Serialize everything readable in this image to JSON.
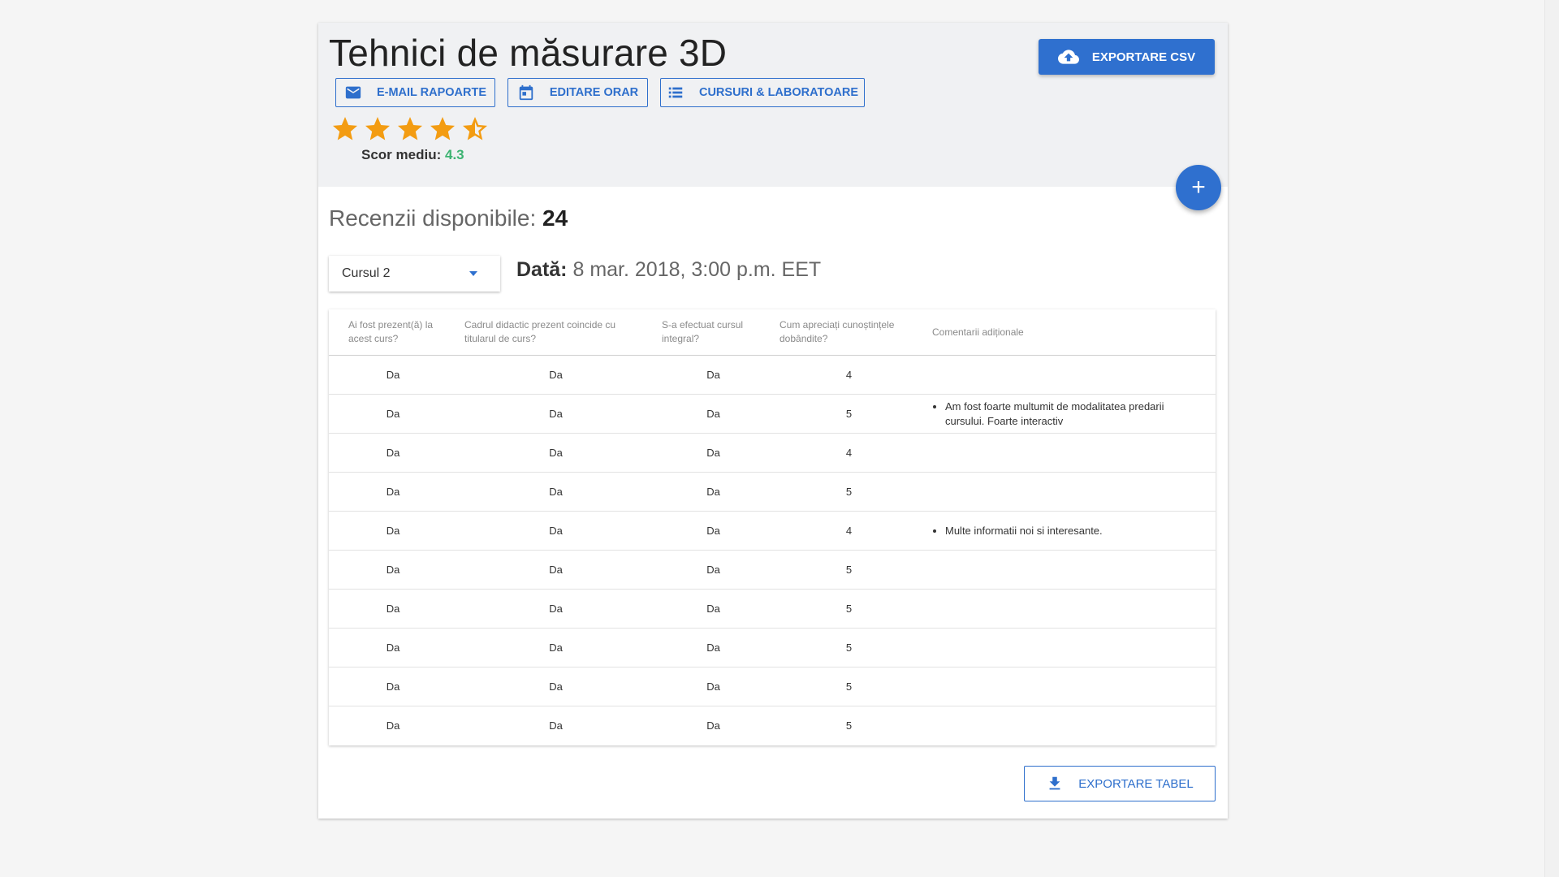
{
  "header": {
    "title": "Tehnici de măsurare 3D",
    "export_csv_label": "Exportare CSV",
    "export_csv_icon": "cloud-upload-icon",
    "actions": [
      {
        "label": "E-mail rapoarte",
        "icon": "email-icon"
      },
      {
        "label": "Editare orar",
        "icon": "calendar-icon"
      },
      {
        "label": "Cursuri & laboratoare",
        "icon": "list-icon"
      }
    ],
    "rating": {
      "stars": 4.5,
      "max": 5,
      "score_label": "Scor mediu:",
      "score_value": "4.3"
    },
    "add_button_label": "+"
  },
  "reviews": {
    "label": "Recenzii disponibile:",
    "count": "24"
  },
  "course_select": {
    "selected": "Cursul 2"
  },
  "date": {
    "label": "Dată:",
    "value": "8 mar. 2018, 3:00 p.m. EET"
  },
  "table": {
    "columns": [
      "Ai fost prezent(ă) la acest curs?",
      "Cadrul didactic prezent coincide cu titularul de curs?",
      "S-a efectuat cursul integral?",
      "Cum apreciați cunoștințele dobândite?",
      "Comentarii adiționale"
    ],
    "rows": [
      {
        "present": "Da",
        "teacher": "Da",
        "integral": "Da",
        "score": "4",
        "comment": ""
      },
      {
        "present": "Da",
        "teacher": "Da",
        "integral": "Da",
        "score": "5",
        "comment": "Am fost foarte multumit de modalitatea predarii cursului. Foarte interactiv"
      },
      {
        "present": "Da",
        "teacher": "Da",
        "integral": "Da",
        "score": "4",
        "comment": ""
      },
      {
        "present": "Da",
        "teacher": "Da",
        "integral": "Da",
        "score": "5",
        "comment": ""
      },
      {
        "present": "Da",
        "teacher": "Da",
        "integral": "Da",
        "score": "4",
        "comment": "Multe informatii noi si interesante."
      },
      {
        "present": "Da",
        "teacher": "Da",
        "integral": "Da",
        "score": "5",
        "comment": ""
      },
      {
        "present": "Da",
        "teacher": "Da",
        "integral": "Da",
        "score": "5",
        "comment": ""
      },
      {
        "present": "Da",
        "teacher": "Da",
        "integral": "Da",
        "score": "5",
        "comment": ""
      },
      {
        "present": "Da",
        "teacher": "Da",
        "integral": "Da",
        "score": "5",
        "comment": ""
      },
      {
        "present": "Da",
        "teacher": "Da",
        "integral": "Da",
        "score": "5",
        "comment": ""
      }
    ]
  },
  "footer": {
    "export_table_label": "Exportare tabel",
    "export_table_icon": "download-icon"
  },
  "colors": {
    "primary": "#2f70cf",
    "star": "#f39c12",
    "score": "#3cb371",
    "header_bg": "#f0f1f3"
  }
}
